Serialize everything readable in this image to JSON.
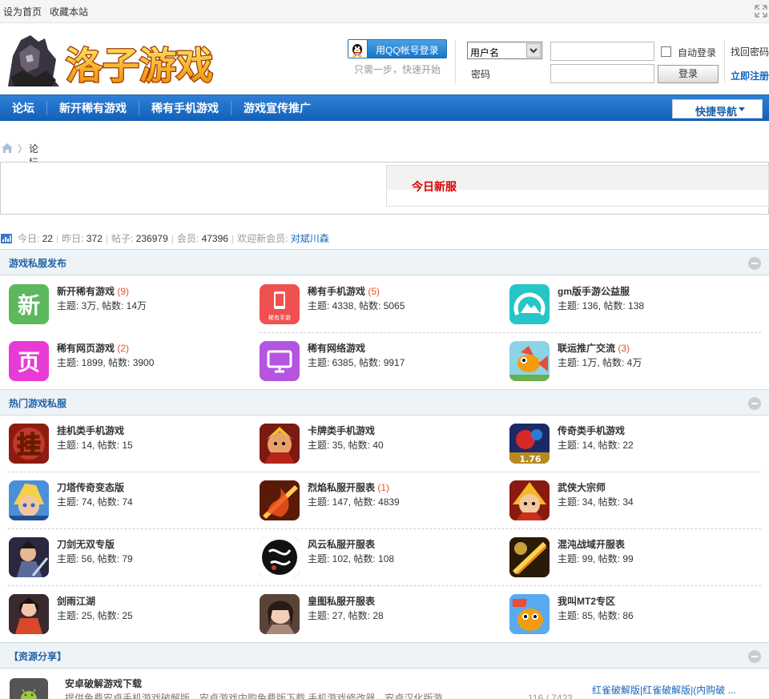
{
  "topbar": {
    "set_home": "设为首页",
    "bookmark": "收藏本站"
  },
  "logo": {
    "text": "洛子游戏"
  },
  "login": {
    "qq_button": "用QQ帐号登录",
    "qq_hint": "只需一步，快速开始",
    "username_select": "用户名",
    "password_label": "密码",
    "auto_login": "自动登录",
    "login_button": "登录",
    "find_password": "找回密码",
    "register": "立即注册"
  },
  "nav": {
    "items": [
      "论坛",
      "新开稀有游戏",
      "稀有手机游戏",
      "游戏宣传推广"
    ],
    "quick_nav": "快捷导航"
  },
  "breadcrumb": {
    "current": "论坛"
  },
  "news": {
    "title": "今日新服"
  },
  "stats": {
    "today_label": "今日:",
    "today": "22",
    "yesterday_label": "昨日:",
    "yesterday": "372",
    "posts_label": "帖子:",
    "posts": "236979",
    "members_label": "会员:",
    "members": "47396",
    "newmember_label": "欢迎新会员:",
    "newmember": "对斌川森"
  },
  "sections": [
    {
      "title": "游戏私服发布",
      "forums": [
        {
          "name": "新开稀有游戏",
          "count": "(9)",
          "meta": "主题: 3万, 帖数: 14万",
          "icon": "xin-icon",
          "color": "#5cb85c"
        },
        {
          "name": "稀有手机游戏",
          "count": "(5)",
          "meta": "主题: 4338, 帖数: 5065",
          "icon": "phone-icon",
          "color": "#f05050",
          "icon_caption": "稀有手游"
        },
        {
          "name": "gm版手游公益服",
          "count": "",
          "meta": "主题: 136, 帖数: 138",
          "icon": "mountain-icon",
          "color": "#26c6c6"
        },
        {
          "name": "稀有网页游戏",
          "count": "(2)",
          "meta": "主题: 1899, 帖数: 3900",
          "icon": "ye-icon",
          "color": "#e83ad6"
        },
        {
          "name": "稀有网络游戏",
          "count": "",
          "meta": "主题: 6385, 帖数: 9917",
          "icon": "monitor-icon",
          "color": "#b455e0"
        },
        {
          "name": "联运推广交流",
          "count": "(3)",
          "meta": "主题: 1万, 帖数: 4万",
          "icon": "fish-icon",
          "color": "#8cd3e6"
        }
      ]
    },
    {
      "title": "热门游戏私服",
      "forums": [
        {
          "name": "挂机类手机游戏",
          "count": "",
          "meta": "主题: 14, 帖数: 15",
          "icon": "gua-icon",
          "color": "#b3261e"
        },
        {
          "name": "卡牌类手机游戏",
          "count": "",
          "meta": "主题: 35, 帖数: 40",
          "icon": "warrior-icon",
          "color": "#c1462a"
        },
        {
          "name": "传奇类手机游戏",
          "count": "",
          "meta": "主题: 14, 帖数: 22",
          "icon": "legend-icon",
          "color": "#2a3a80"
        },
        {
          "name": "刀塔传奇变态版",
          "count": "",
          "meta": "主题: 74, 帖数: 74",
          "icon": "hero-icon",
          "color": "#3b76c4"
        },
        {
          "name": "烈焰私服开服表",
          "count": "(1)",
          "meta": "主题: 147, 帖数: 4839",
          "icon": "flame-icon",
          "color": "#c53a12"
        },
        {
          "name": "武侠大宗师",
          "count": "",
          "meta": "主题: 34, 帖数: 34",
          "icon": "wuxia-icon",
          "color": "#d2452a"
        },
        {
          "name": "刀剑无双专版",
          "count": "",
          "meta": "主题: 56, 帖数: 79",
          "icon": "sword-icon",
          "color": "#3d3a55"
        },
        {
          "name": "风云私服开服表",
          "count": "",
          "meta": "主题: 102, 帖数: 108",
          "icon": "fengyun-icon",
          "color": "#1a1a1a"
        },
        {
          "name": "混沌战域开服表",
          "count": "",
          "meta": "主题: 99, 帖数: 99",
          "icon": "chaos-icon",
          "color": "#7a5a1a"
        },
        {
          "name": "剑雨江湖",
          "count": "",
          "meta": "主题: 25, 帖数: 25",
          "icon": "jianyu-icon",
          "color": "#a5381e"
        },
        {
          "name": "皇图私服开服表",
          "count": "",
          "meta": "主题: 27, 帖数: 28",
          "icon": "huangtu-icon",
          "color": "#8a6a58"
        },
        {
          "name": "我叫MT2专区",
          "count": "",
          "meta": "主题: 85, 帖数: 86",
          "icon": "mt-icon",
          "color": "#3c8ee0"
        }
      ]
    },
    {
      "title": "【资源分享】",
      "forums": []
    }
  ],
  "resource": {
    "title": "安卓破解游戏下载",
    "desc": "提供免费安卓手机游戏破解版、安卓游戏内购免费版下载,手机游戏修改器、安卓汉化版游",
    "nums": "116 / 7423",
    "last_post": "红雀破解版|红雀破解版|(内购破 ..."
  }
}
